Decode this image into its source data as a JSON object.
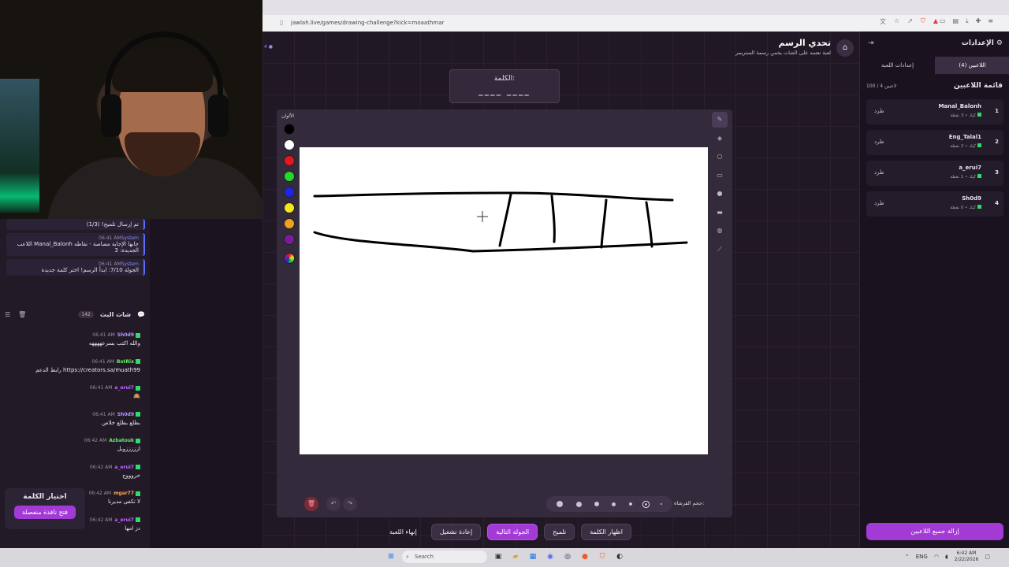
{
  "browser": {
    "url": "jawlah.live/games/drawing-challenge?kick=moaathmar"
  },
  "left_panel": {
    "system_messages": [
      {
        "sender": "",
        "time": "",
        "text": "تم إرسال تلميح! (1/3)"
      },
      {
        "sender": "System",
        "time": "06:41 AM",
        "text": "اللاعب Manal_Balonh جابها الإجابة مصاصة - نقاطه الجديدة: 3"
      },
      {
        "sender": "System",
        "time": "06:41 AM",
        "text": "الجولة 7/10: ابدأ الرسم! اختر كلمة جديدة"
      }
    ],
    "chat_title": "شات البث",
    "chat_count": "142",
    "messages": [
      {
        "user": "Sh0d9",
        "user_color": "#b695ff",
        "time": "06:41 AM",
        "text": "والله اكتب بسرعههههه"
      },
      {
        "user": "BotRix",
        "user_color": "#6ee96e",
        "time": "06:41 AM",
        "text": "رابط الدعم https://creators.sa/muath99"
      },
      {
        "user": "a_erui7",
        "user_color": "#c264ff",
        "time": "06:41 AM",
        "text": "🙈"
      },
      {
        "user": "Sh0d9",
        "user_color": "#b695ff",
        "time": "06:41 AM",
        "text": "بطلع بطلع خلاص"
      },
      {
        "user": "Azbatouk",
        "user_color": "#6ee96e",
        "time": "06:42 AM",
        "text": "ازززززوبل"
      },
      {
        "user": "a_erui7",
        "user_color": "#c264ff",
        "time": "06:42 AM",
        "text": "خروووج"
      },
      {
        "user": "mgar77",
        "user_color": "#ffa852",
        "time": "06:42 AM",
        "text": "لا تكفى مديرنا"
      },
      {
        "user": "a_erui7",
        "user_color": "#c264ff",
        "time": "06:42 AM",
        "text": "دز امها"
      }
    ],
    "choose_word": {
      "title": "اختيار الكلمة",
      "button": "فتح نافذة منفصلة"
    }
  },
  "game": {
    "title": "تحدي الرسم",
    "subtitle": "لعبة تعتمد على الشات يخمن رسمة الستريمر",
    "pager": "4",
    "word_label": "الكلمة:",
    "word_mask": "____  ____",
    "colors_label": "الألوان",
    "colors": [
      "#000000",
      "#ffffff",
      "#e5161b",
      "#23d82a",
      "#1c27e5",
      "#f2e51b",
      "#f1a01f",
      "#7a1b9e"
    ],
    "brush_label": "حجم الفرشاة:",
    "brush_sizes": [
      8,
      7,
      6,
      5,
      4,
      3,
      2
    ],
    "selected_brush_index": 5,
    "actions": [
      "إنهاء اللعبة",
      "إعادة تشغيل",
      "الجولة التالية",
      "تلميح",
      "اظهار الكلمة"
    ]
  },
  "settings": {
    "title": "الإعدادات",
    "tab_players": "اللاعبين (4)",
    "tab_game": "إعدادات اللعبة",
    "list_title": "قائمة اللاعبين",
    "list_count": "100 / 4 لاعبين",
    "kick_label": "طرد",
    "players": [
      {
        "rank": "1",
        "name": "Manal_Balonh",
        "points": "كيك • 3 نقطة"
      },
      {
        "rank": "2",
        "name": "Eng_Talal1",
        "points": "كيك • 2 نقطة"
      },
      {
        "rank": "3",
        "name": "a_erui7",
        "points": "كيك • 1 نقطة"
      },
      {
        "rank": "4",
        "name": "Sh0d9",
        "points": "كيك • 0 نقطة"
      }
    ],
    "remove_all": "إزالة جميع اللاعبين"
  },
  "taskbar": {
    "search_placeholder": "Search",
    "lang": "ENG",
    "time": "6:42 AM",
    "date": "2/22/2026"
  }
}
